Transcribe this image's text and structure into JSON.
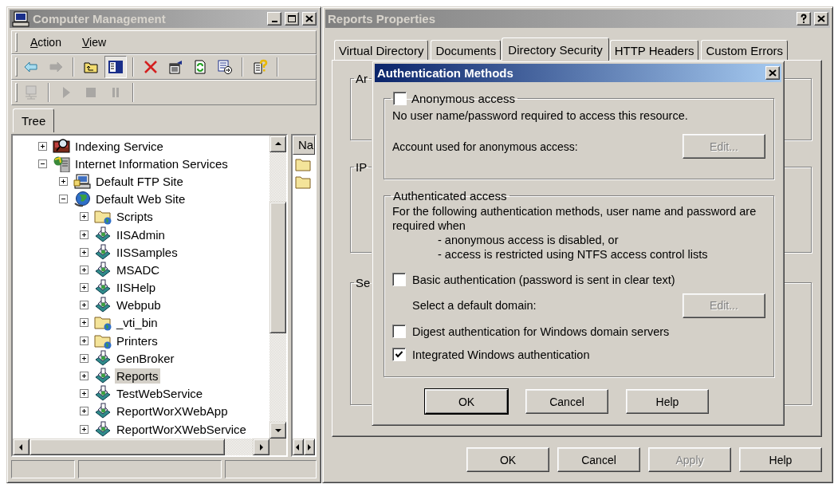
{
  "computer_management": {
    "title": "Computer Management",
    "active": false,
    "menu": [
      "Action",
      "View"
    ],
    "toolbar_rows": [
      [
        [
          {
            "kind": "back",
            "disabled": false,
            "pressed": false
          },
          {
            "kind": "forward",
            "disabled": true,
            "pressed": false
          }
        ],
        [
          {
            "kind": "up",
            "disabled": false,
            "pressed": false
          },
          {
            "kind": "tree",
            "disabled": false,
            "pressed": true
          }
        ],
        [
          {
            "kind": "delete",
            "disabled": false,
            "pressed": false
          },
          {
            "kind": "properties",
            "disabled": false,
            "pressed": false
          },
          {
            "kind": "refresh",
            "disabled": false,
            "pressed": false
          },
          {
            "kind": "export",
            "disabled": false,
            "pressed": false
          }
        ],
        [
          {
            "kind": "help",
            "disabled": false,
            "pressed": false
          }
        ]
      ],
      [
        [
          {
            "kind": "computer",
            "disabled": true,
            "pressed": false
          }
        ],
        [
          {
            "kind": "play",
            "disabled": true,
            "pressed": false
          },
          {
            "kind": "stop",
            "disabled": true,
            "pressed": false
          },
          {
            "kind": "pause",
            "disabled": true,
            "pressed": false
          }
        ]
      ]
    ],
    "tree_tab": {
      "label": "Tree",
      "selected": true
    },
    "tree": [
      {
        "label": "Indexing Service",
        "kind": "indexing",
        "expanded": false,
        "selected": false
      },
      {
        "label": "Internet Information Services",
        "kind": "iis",
        "expanded": true,
        "selected": false,
        "children": [
          {
            "label": "Default FTP Site",
            "kind": "ftp",
            "expanded": false,
            "selected": false
          },
          {
            "label": "Default Web Site",
            "kind": "web",
            "expanded": true,
            "selected": false,
            "children": [
              {
                "label": "Scripts",
                "kind": "folder",
                "expanded": false,
                "selected": false
              },
              {
                "label": "IISAdmin",
                "kind": "app",
                "expanded": false,
                "selected": false
              },
              {
                "label": "IISSamples",
                "kind": "app",
                "expanded": false,
                "selected": false
              },
              {
                "label": "MSADC",
                "kind": "app",
                "expanded": false,
                "selected": false
              },
              {
                "label": "IISHelp",
                "kind": "app",
                "expanded": false,
                "selected": false
              },
              {
                "label": "Webpub",
                "kind": "app",
                "expanded": false,
                "selected": false
              },
              {
                "label": "_vti_bin",
                "kind": "folder",
                "expanded": false,
                "selected": false
              },
              {
                "label": "Printers",
                "kind": "folder",
                "expanded": false,
                "selected": false
              },
              {
                "label": "GenBroker",
                "kind": "app",
                "expanded": false,
                "selected": false
              },
              {
                "label": "Reports",
                "kind": "app",
                "expanded": false,
                "selected": true
              },
              {
                "label": "TestWebService",
                "kind": "app",
                "expanded": false,
                "selected": false
              },
              {
                "label": "ReportWorXWebApp",
                "kind": "app",
                "expanded": false,
                "selected": false
              },
              {
                "label": "ReportWorXWebService",
                "kind": "app",
                "expanded": false,
                "selected": false
              }
            ]
          }
        ]
      }
    ],
    "list_header": "Na"
  },
  "reports_properties": {
    "title": "Reports Properties",
    "active": false,
    "tabs": [
      {
        "label": "Virtual Directory",
        "selected": false
      },
      {
        "label": "Documents",
        "selected": false
      },
      {
        "label": "Directory Security",
        "selected": true
      },
      {
        "label": "HTTP Headers",
        "selected": false
      },
      {
        "label": "Custom Errors",
        "selected": false
      }
    ],
    "groups": [
      "Ar",
      "IP",
      "Se"
    ],
    "buttons": [
      {
        "label": "OK",
        "disabled": false
      },
      {
        "label": "Cancel",
        "disabled": false
      },
      {
        "label": "Apply",
        "disabled": true
      },
      {
        "label": "Help",
        "disabled": false
      }
    ]
  },
  "auth_dialog": {
    "title": "Authentication Methods",
    "active": true,
    "anonymous": {
      "label": "Anonymous access",
      "checked": false,
      "description": "No user name/password required to access this resource.",
      "account_label": "Account used for anonymous access:",
      "edit_button": {
        "label": "Edit...",
        "disabled": true
      }
    },
    "authenticated": {
      "label": "Authenticated access",
      "intro": "For the following authentication methods, user name and password are required when",
      "conditions": [
        "- anonymous access is disabled, or",
        "- access is restricted using NTFS access control lists"
      ],
      "options": [
        {
          "kind": "checkbox",
          "label": "Basic authentication (password is sent in clear text)",
          "checked": false
        },
        {
          "kind": "domain",
          "label": "Select a default domain:",
          "button": {
            "label": "Edit...",
            "disabled": true
          }
        },
        {
          "kind": "checkbox",
          "label": "Digest authentication for Windows domain servers",
          "checked": false
        },
        {
          "kind": "checkbox",
          "label": "Integrated Windows authentication",
          "checked": true
        }
      ]
    },
    "buttons": [
      {
        "label": "OK",
        "default": true
      },
      {
        "label": "Cancel",
        "default": false
      },
      {
        "label": "Help",
        "default": false
      }
    ]
  }
}
